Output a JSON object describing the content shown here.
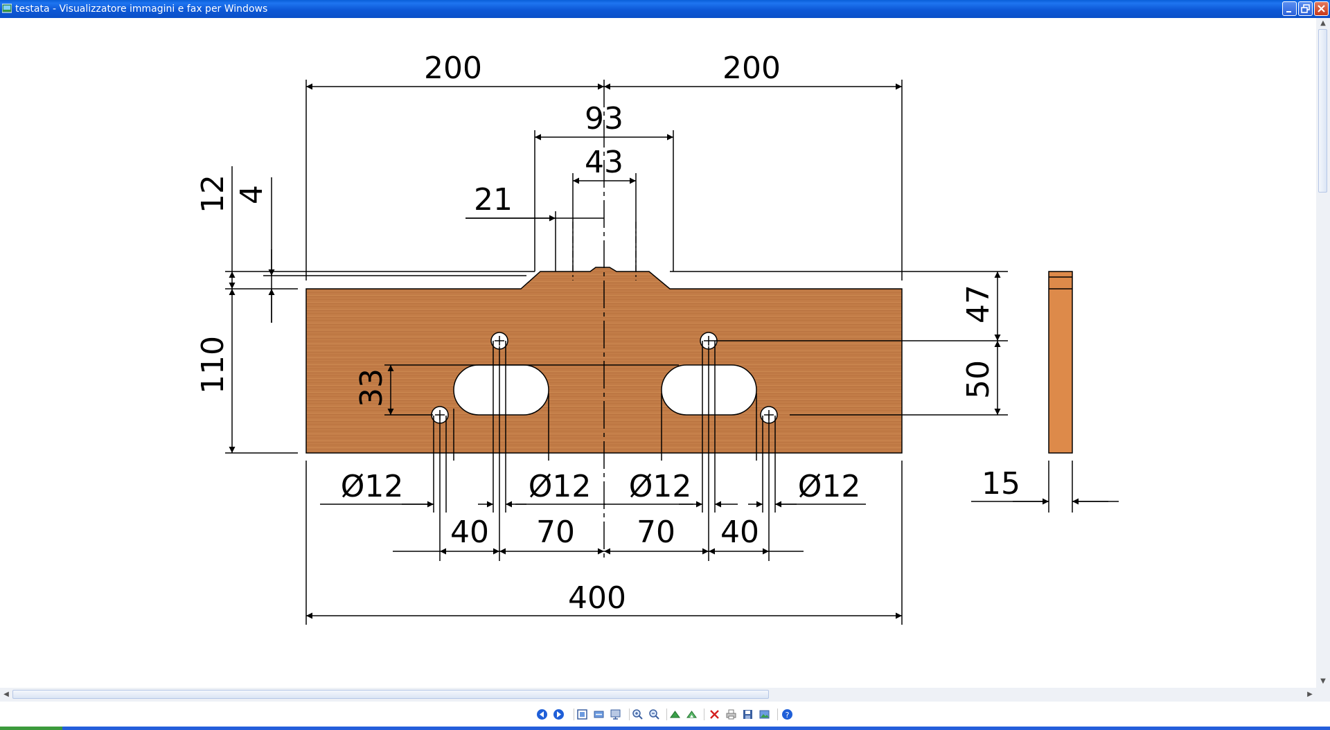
{
  "window": {
    "title": "testata - Visualizzatore immagini e fax per Windows",
    "accent_color": "#0a55d2",
    "controls": [
      "minimize-icon",
      "restore-icon",
      "close-icon"
    ]
  },
  "drawing": {
    "wood_color": "#c07a45",
    "dims": {
      "top_left_width": "200",
      "top_right_width": "200",
      "center_93": "93",
      "center_43": "43",
      "center_21": "21",
      "left_12": "12",
      "left_4": "4",
      "left_110": "110",
      "left_33": "33",
      "right_47": "47",
      "right_50": "50",
      "thickness_15": "15",
      "hole_1": "Ø12",
      "hole_2": "Ø12",
      "hole_3": "Ø12",
      "hole_4": "Ø12",
      "gap_40_left": "40",
      "gap_70_left": "70",
      "gap_70_right": "70",
      "gap_40_right": "40",
      "total_400": "400"
    }
  },
  "toolbar": {
    "buttons": [
      "previous-image-icon",
      "next-image-icon",
      "best-fit-icon",
      "actual-size-icon",
      "slideshow-icon",
      "zoom-in-icon",
      "zoom-out-icon",
      "rotate-clockwise-icon",
      "rotate-counterclockwise-icon",
      "delete-icon",
      "print-icon",
      "save-icon",
      "edit-icon",
      "help-icon"
    ]
  }
}
